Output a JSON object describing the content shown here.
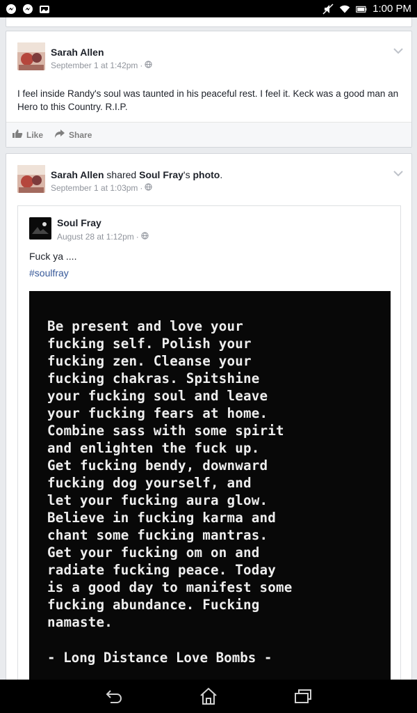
{
  "status_bar": {
    "time": "1:00 PM",
    "left_icons": [
      "messenger-icon",
      "messenger-icon",
      "photo-icon"
    ],
    "right_icons": [
      "mute-icon",
      "wifi-icon",
      "battery-icon"
    ]
  },
  "posts": [
    {
      "author": "Sarah Allen",
      "timestamp": "September 1 at 1:42pm",
      "text": "I feel inside Randy's soul was taunted in his peaceful rest. I feel it. Keck was a good man an Hero to this Country. R.I.P.",
      "actions": {
        "like": "Like",
        "share": "Share"
      }
    },
    {
      "author": "Sarah Allen",
      "shared_word": " shared ",
      "shared_from": "Soul Fray",
      "shared_suffix": "'s ",
      "shared_object": "photo",
      "shared_end": ".",
      "timestamp": "September 1 at 1:03pm",
      "shared_post": {
        "author": "Soul Fray",
        "timestamp": "August 28 at 1:12pm",
        "text": "Fuck ya ....",
        "hashtag": "#soulfray",
        "image_text": "Be present and love your\nfucking self. Polish your\nfucking zen. Cleanse your\nfucking chakras. Spitshine\nyour fucking soul and leave\nyour fucking fears at home.\nCombine sass with some spirit\nand enlighten the fuck up.\nGet fucking bendy, downward\nfucking dog yourself, and\nlet your fucking aura glow.\nBelieve in fucking karma and\nchant some fucking mantras.\nGet your fucking om on and\nradiate fucking peace. Today\nis a good day to manifest some\nfucking abundance. Fucking\nnamaste.",
        "image_attribution": "- Long Distance Love Bombs -"
      }
    }
  ],
  "colors": {
    "link": "#365899",
    "meta": "#90949c",
    "background": "#e9ebee"
  }
}
